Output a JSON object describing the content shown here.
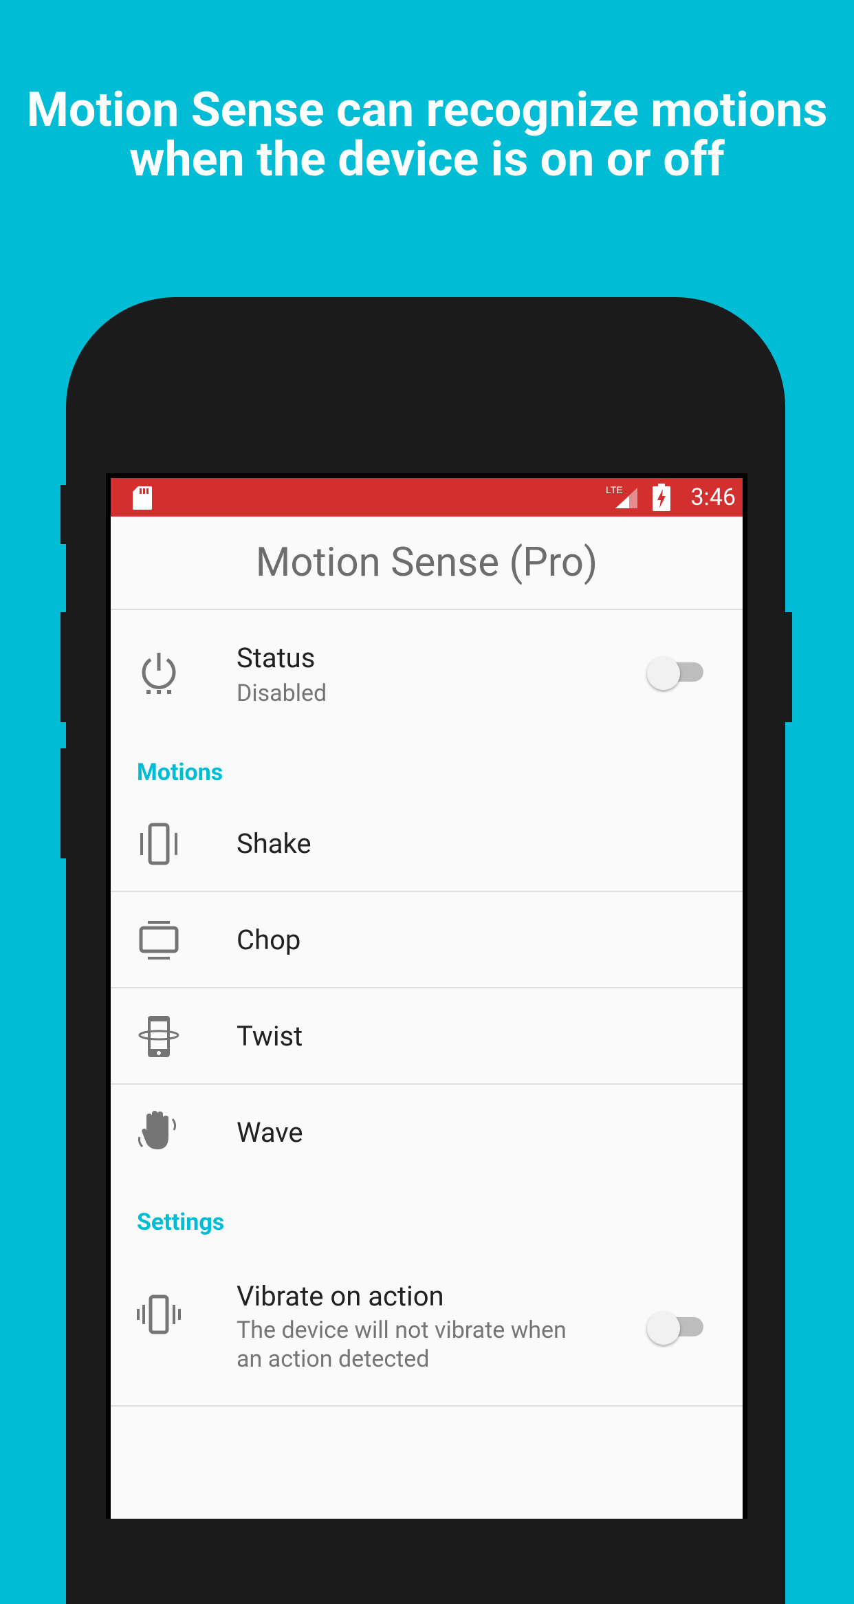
{
  "headline": {
    "line1": "Motion Sense can recognize motions",
    "line2": "when the device is on or off"
  },
  "status_bar": {
    "time": "3:46",
    "network": "LTE",
    "icons": [
      "sd-card-icon",
      "lte-signal-icon",
      "battery-charging-icon"
    ],
    "color": "#D32F2F"
  },
  "app": {
    "title": "Motion Sense (Pro)",
    "status": {
      "label": "Status",
      "value": "Disabled",
      "enabled": false,
      "icon": "power-icon"
    },
    "motions_header": "Motions",
    "motions": [
      {
        "label": "Shake",
        "icon": "shake-phone-icon"
      },
      {
        "label": "Chop",
        "icon": "chop-phone-icon"
      },
      {
        "label": "Twist",
        "icon": "twist-phone-icon"
      },
      {
        "label": "Wave",
        "icon": "wave-hand-icon"
      }
    ],
    "settings_header": "Settings",
    "vibrate": {
      "label": "Vibrate on action",
      "description_line1": "The device will not vibrate when",
      "description_line2": "an action detected",
      "enabled": false,
      "icon": "vibrate-icon"
    }
  },
  "colors": {
    "background": "#00BCD4",
    "accent": "#00BCD4",
    "phone": "#1b1b1b"
  }
}
